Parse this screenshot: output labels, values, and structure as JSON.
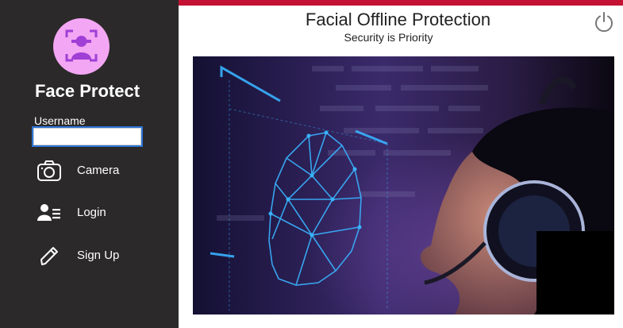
{
  "sidebar": {
    "logo_icon": "face-scan-icon",
    "brand": "Face Protect",
    "username_label": "Username",
    "username_value": "",
    "items": [
      {
        "label": "Camera",
        "icon": "camera-icon"
      },
      {
        "label": "Login",
        "icon": "user-list-icon"
      },
      {
        "label": "Sign Up",
        "icon": "pencil-icon"
      }
    ]
  },
  "header": {
    "title": "Facial Offline Protection",
    "subtitle": "Security is Priority",
    "power_icon": "power-icon"
  },
  "colors": {
    "sidebar_bg": "#2b2929",
    "accent_bar": "#c41234",
    "logo_bg": "#f3a6f3",
    "logo_icon": "#a03fd6",
    "scan_lines": "#39b3ff"
  }
}
